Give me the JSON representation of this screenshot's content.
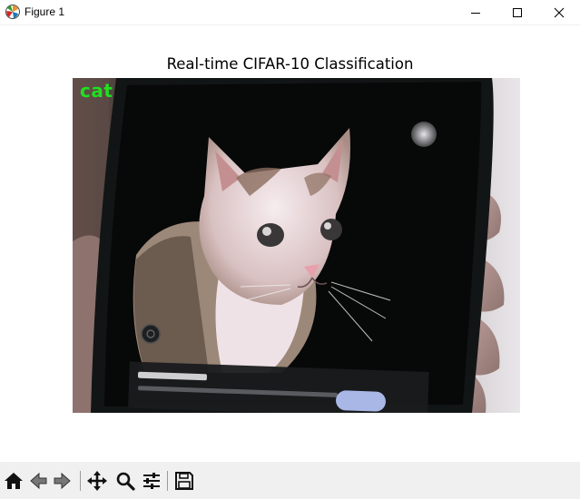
{
  "window": {
    "title": "Figure 1"
  },
  "figure": {
    "title": "Real-time CIFAR-10 Classification",
    "prediction_label": "cat",
    "prediction_color": "#1fe01f"
  },
  "toolbar": {
    "buttons": [
      "home-icon",
      "back-arrow-icon",
      "forward-arrow-icon",
      "pan-icon",
      "zoom-icon",
      "configure-subplots-icon",
      "save-icon"
    ]
  }
}
